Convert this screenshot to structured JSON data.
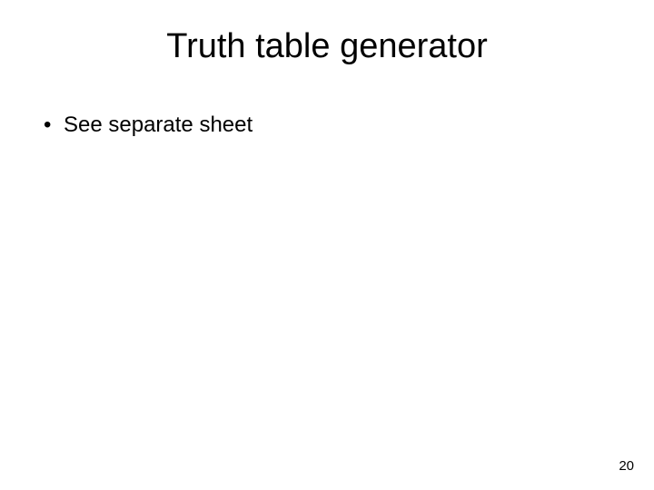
{
  "slide": {
    "title": "Truth table generator",
    "bullets": [
      "See separate sheet"
    ],
    "page_number": "20"
  }
}
